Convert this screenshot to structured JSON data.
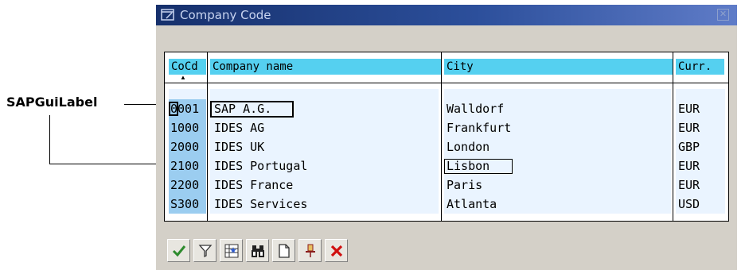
{
  "annotation": {
    "label": "SAPGuiLabel"
  },
  "dialog": {
    "title": "Company Code",
    "close_icon": "close-icon",
    "title_icon": "dialog-window-icon"
  },
  "table": {
    "columns": [
      "CoCd",
      "Company name",
      "City",
      "Curr."
    ],
    "rows": [
      {
        "code": "0001",
        "name": "SAP A.G.",
        "city": "Walldorf",
        "currency": "EUR"
      },
      {
        "code": "1000",
        "name": "IDES AG",
        "city": "Frankfurt",
        "currency": "EUR"
      },
      {
        "code": "2000",
        "name": "IDES UK",
        "city": "London",
        "currency": "GBP"
      },
      {
        "code": "2100",
        "name": "IDES Portugal",
        "city": "Lisbon",
        "currency": "EUR"
      },
      {
        "code": "2200",
        "name": "IDES France",
        "city": "Paris",
        "currency": "EUR"
      },
      {
        "code": "S300",
        "name": "IDES Services",
        "city": "Atlanta",
        "currency": "USD"
      }
    ]
  },
  "toolbar": {
    "buttons": [
      {
        "icon": "checkmark-icon",
        "color": "#2e8b2e"
      },
      {
        "icon": "filter-icon",
        "color": "#333333"
      },
      {
        "icon": "sort-icon",
        "color": "#333333"
      },
      {
        "icon": "binoculars-icon",
        "color": "#222222"
      },
      {
        "icon": "new-document-icon",
        "color": "#333333"
      },
      {
        "icon": "pushpin-icon",
        "color": "#8a1c1c"
      },
      {
        "icon": "cancel-icon",
        "color": "#d01010"
      }
    ]
  },
  "colors": {
    "header_bg": "#55d0f0",
    "code_cell_bg": "#9bcdf0",
    "title_bar": "#16306c",
    "dialog_bg": "#d4d0c8"
  }
}
